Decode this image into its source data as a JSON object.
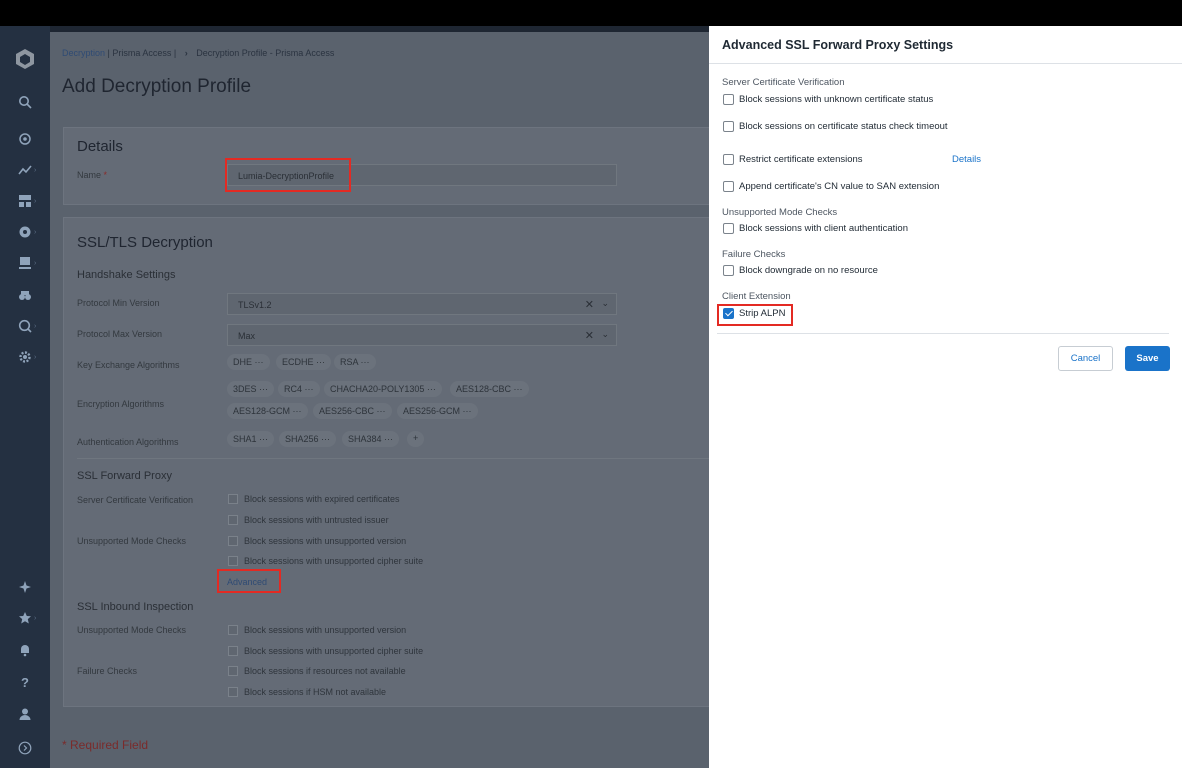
{
  "breadcrumb": {
    "link": "Decryption",
    "sep1": "| Prisma Access |",
    "current": "Decryption Profile - Prisma Access"
  },
  "page_title": "Add Decryption Profile",
  "details": {
    "title": "Details",
    "name_label": "Name",
    "required_mark": "*",
    "name_value": "Lumia-DecryptionProfile"
  },
  "ssl": {
    "title": "SSL/TLS Decryption",
    "handshake": "Handshake Settings",
    "min_label": "Protocol Min Version",
    "min_value": "TLSv1.2",
    "max_label": "Protocol Max Version",
    "max_value": "Max",
    "kex_label": "Key Exchange Algorithms",
    "kex": [
      "DHE",
      "ECDHE",
      "RSA"
    ],
    "enc_label": "Encryption Algorithms",
    "enc_row1": [
      "3DES",
      "RC4",
      "CHACHA20-POLY1305",
      "AES128-CBC"
    ],
    "enc_row2": [
      "AES128-GCM",
      "AES256-CBC",
      "AES256-GCM"
    ],
    "auth_label": "Authentication Algorithms",
    "auth": [
      "SHA1",
      "SHA256",
      "SHA384"
    ],
    "fwd_title": "SSL Forward Proxy",
    "fwd_scv": "Server Certificate Verification",
    "fwd_umc": "Unsupported Mode Checks",
    "fwd_opts": [
      "Block sessions with expired certificates",
      "Block sessions with untrusted issuer",
      "Block sessions with unsupported version",
      "Block sessions with unsupported cipher suite"
    ],
    "advanced": "Advanced",
    "inb_title": "SSL Inbound Inspection",
    "inb_umc": "Unsupported Mode Checks",
    "inb_fail": "Failure Checks",
    "inb_opts": [
      "Block sessions with unsupported version",
      "Block sessions with unsupported cipher suite",
      "Block sessions if resources not available",
      "Block sessions if HSM not available"
    ]
  },
  "required_field": "* Required Field",
  "panel": {
    "title": "Advanced SSL Forward Proxy Settings",
    "scv_title": "Server Certificate Verification",
    "opt_unknown": "Block sessions with unknown certificate status",
    "opt_timeout": "Block sessions on certificate status check timeout",
    "opt_restrict": "Restrict certificate extensions",
    "details_link": "Details",
    "opt_append": "Append certificate's CN value to SAN extension",
    "umc_title": "Unsupported Mode Checks",
    "opt_client_auth": "Block sessions with client authentication",
    "fail_title": "Failure Checks",
    "opt_downgrade": "Block downgrade on no resource",
    "ce_title": "Client Extension",
    "opt_strip": "Strip ALPN",
    "cancel": "Cancel",
    "save": "Save"
  },
  "colors": {
    "accent": "#1a73c9",
    "highlight": "#e32a23"
  }
}
